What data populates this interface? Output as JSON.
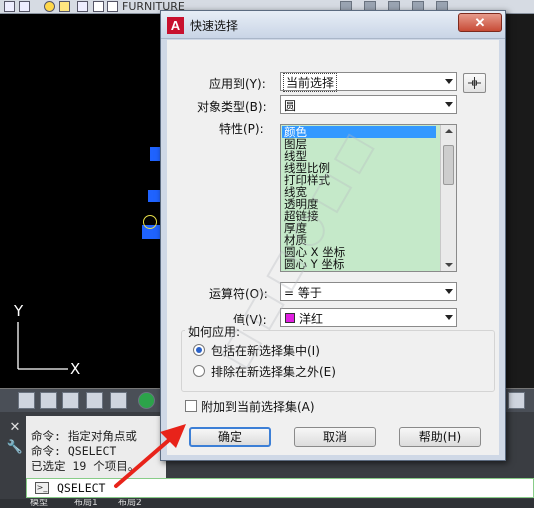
{
  "background": {
    "layer_name": "FURNITURE",
    "command_history": [
      "命令: 指定对角点或",
      "命令: QSELECT",
      "已选定 19 个项目。"
    ],
    "command_input": "QSELECT",
    "layout_tabs": [
      "模型",
      "布局1",
      "布局2"
    ]
  },
  "dialog": {
    "title": "快速选择",
    "close_symbol": "✕",
    "apply_to": {
      "label": "应用到(Y):",
      "value": "当前选择"
    },
    "object_type": {
      "label": "对象类型(B):",
      "value": "圆"
    },
    "properties": {
      "label": "特性(P):",
      "items": [
        "颜色",
        "图层",
        "线型",
        "线型比例",
        "打印样式",
        "线宽",
        "透明度",
        "超链接",
        "厚度",
        "材质",
        "圆心 X 坐标",
        "圆心 Y 坐标"
      ],
      "selected_index": 0
    },
    "operator": {
      "label": "运算符(O):",
      "value": "= 等于"
    },
    "value": {
      "label": "值(V):",
      "value": "洋红",
      "swatch_color": "#e01fe0"
    },
    "how_to_apply": {
      "legend": "如何应用:",
      "options": [
        {
          "label": "包括在新选择集中(I)",
          "checked": true
        },
        {
          "label": "排除在新选择集之外(E)",
          "checked": false
        }
      ]
    },
    "append_checkbox": {
      "label": "附加到当前选择集(A)",
      "checked": false
    },
    "buttons": {
      "ok": "确定",
      "cancel": "取消",
      "help": "帮助(H)"
    }
  },
  "colors": {
    "list_bg": "#c5e9c9",
    "selection": "#3399ff",
    "close_button": "#c74b36",
    "annotation_arrow": "#e8231a"
  }
}
